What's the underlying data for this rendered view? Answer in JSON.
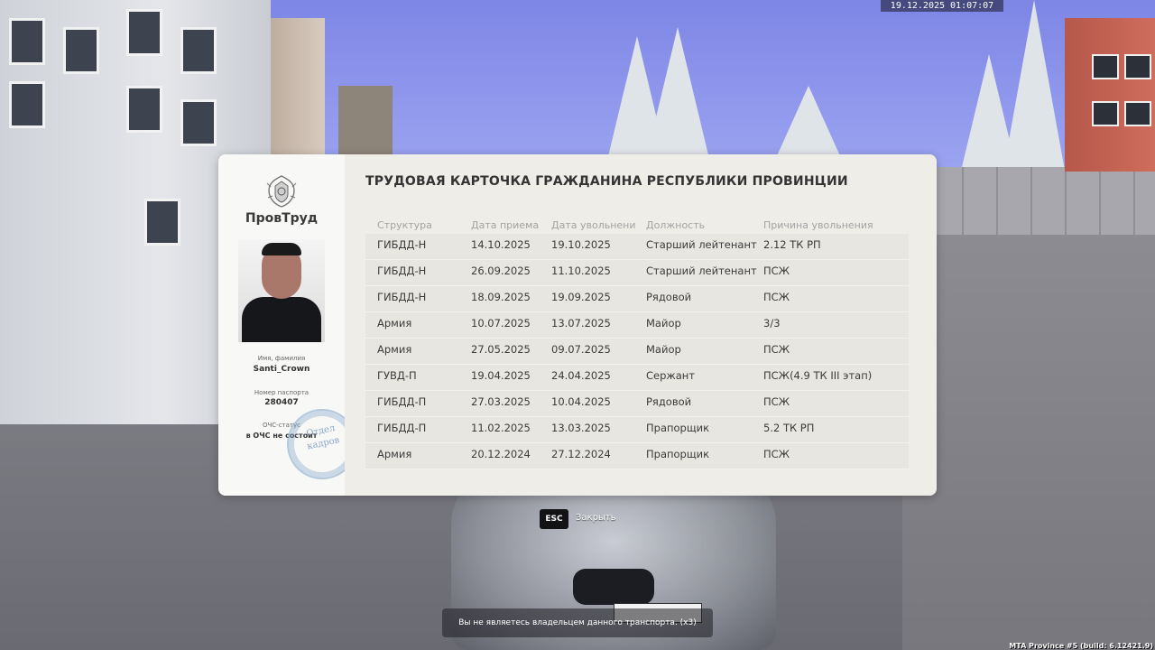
{
  "hud": {
    "timestamp": "19.12.2025 01:07:07",
    "build_info": "MTA Province #5 (build: 6.12421.9)",
    "notice": "Вы не являетесь владельцем данного транспорта. (x3)"
  },
  "card": {
    "org_name": "ПровТруд",
    "title": "ТРУДОВАЯ КАРТОЧКА ГРАЖДАНИНА РЕСПУБЛИКИ ПРОВИНЦИИ",
    "name_label": "Имя, фамилия",
    "name_value": "Santi_Crown",
    "passport_label": "Номер паспорта",
    "passport_value": "280407",
    "ochs_label": "ОЧС-статус",
    "ochs_value": "в ОЧС не состоит",
    "stamp_text": "Отдел кадров",
    "columns": [
      "Структура",
      "Дата приема",
      "Дата увольнени",
      "Должность",
      "Причина увольнения"
    ],
    "rows": [
      [
        "ГИБДД-Н",
        "14.10.2025",
        "19.10.2025",
        "Старший лейтенант",
        "2.12 ТК РП"
      ],
      [
        "ГИБДД-Н",
        "26.09.2025",
        "11.10.2025",
        "Старший лейтенант",
        "ПСЖ"
      ],
      [
        "ГИБДД-Н",
        "18.09.2025",
        "19.09.2025",
        "Рядовой",
        "ПСЖ"
      ],
      [
        "Армия",
        "10.07.2025",
        "13.07.2025",
        "Майор",
        "3/3"
      ],
      [
        "Армия",
        "27.05.2025",
        "09.07.2025",
        "Майор",
        "ПСЖ"
      ],
      [
        "ГУВД-П",
        "19.04.2025",
        "24.04.2025",
        "Сержант",
        "ПСЖ(4.9 ТК III этап)"
      ],
      [
        "ГИБДД-П",
        "27.03.2025",
        "10.04.2025",
        "Рядовой",
        "ПСЖ"
      ],
      [
        "ГИБДД-П",
        "11.02.2025",
        "13.03.2025",
        "Прапорщик",
        "5.2 ТК РП"
      ],
      [
        "Армия",
        "20.12.2024",
        "27.12.2024",
        "Прапорщик",
        "ПСЖ"
      ]
    ]
  },
  "close": {
    "key": "ESC",
    "label": "Закрыть"
  }
}
